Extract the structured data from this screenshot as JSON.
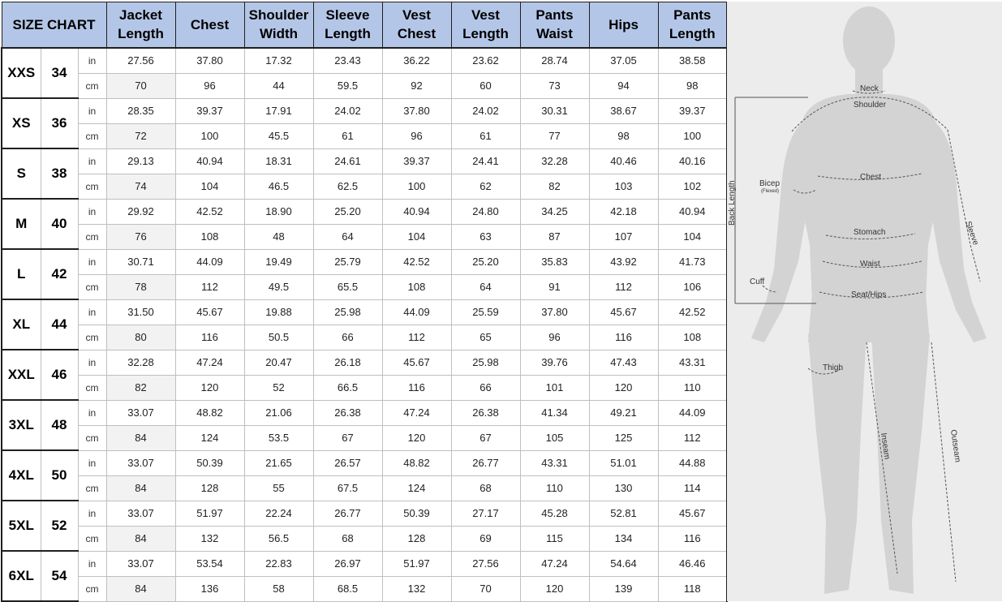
{
  "table": {
    "title": "SIZE CHART",
    "headers": [
      "Jacket\nLength",
      "Chest",
      "Shoulder\nWidth",
      "Sleeve\nLength",
      "Vest\nChest",
      "Vest\nLength",
      "Pants\nWaist",
      "Hips",
      "Pants\nLength"
    ],
    "header_lines": [
      [
        "Jacket",
        "Length"
      ],
      [
        "Chest",
        ""
      ],
      [
        "Shoulder",
        "Width"
      ],
      [
        "Sleeve",
        "Length"
      ],
      [
        "Vest",
        "Chest"
      ],
      [
        "Vest",
        "Length"
      ],
      [
        "Pants",
        "Waist"
      ],
      [
        "Hips",
        ""
      ],
      [
        "Pants",
        "Length"
      ]
    ],
    "units": {
      "in": "in",
      "cm": "cm"
    },
    "rows": [
      {
        "size": "XXS",
        "num": "34",
        "in": [
          "27.56",
          "37.80",
          "17.32",
          "23.43",
          "36.22",
          "23.62",
          "28.74",
          "37.05",
          "38.58"
        ],
        "cm": [
          "70",
          "96",
          "44",
          "59.5",
          "92",
          "60",
          "73",
          "94",
          "98"
        ]
      },
      {
        "size": "XS",
        "num": "36",
        "in": [
          "28.35",
          "39.37",
          "17.91",
          "24.02",
          "37.80",
          "24.02",
          "30.31",
          "38.67",
          "39.37"
        ],
        "cm": [
          "72",
          "100",
          "45.5",
          "61",
          "96",
          "61",
          "77",
          "98",
          "100"
        ]
      },
      {
        "size": "S",
        "num": "38",
        "in": [
          "29.13",
          "40.94",
          "18.31",
          "24.61",
          "39.37",
          "24.41",
          "32.28",
          "40.46",
          "40.16"
        ],
        "cm": [
          "74",
          "104",
          "46.5",
          "62.5",
          "100",
          "62",
          "82",
          "103",
          "102"
        ]
      },
      {
        "size": "M",
        "num": "40",
        "in": [
          "29.92",
          "42.52",
          "18.90",
          "25.20",
          "40.94",
          "24.80",
          "34.25",
          "42.18",
          "40.94"
        ],
        "cm": [
          "76",
          "108",
          "48",
          "64",
          "104",
          "63",
          "87",
          "107",
          "104"
        ]
      },
      {
        "size": "L",
        "num": "42",
        "in": [
          "30.71",
          "44.09",
          "19.49",
          "25.79",
          "42.52",
          "25.20",
          "35.83",
          "43.92",
          "41.73"
        ],
        "cm": [
          "78",
          "112",
          "49.5",
          "65.5",
          "108",
          "64",
          "91",
          "112",
          "106"
        ]
      },
      {
        "size": "XL",
        "num": "44",
        "in": [
          "31.50",
          "45.67",
          "19.88",
          "25.98",
          "44.09",
          "25.59",
          "37.80",
          "45.67",
          "42.52"
        ],
        "cm": [
          "80",
          "116",
          "50.5",
          "66",
          "112",
          "65",
          "96",
          "116",
          "108"
        ]
      },
      {
        "size": "XXL",
        "num": "46",
        "in": [
          "32.28",
          "47.24",
          "20.47",
          "26.18",
          "45.67",
          "25.98",
          "39.76",
          "47.43",
          "43.31"
        ],
        "cm": [
          "82",
          "120",
          "52",
          "66.5",
          "116",
          "66",
          "101",
          "120",
          "110"
        ]
      },
      {
        "size": "3XL",
        "num": "48",
        "in": [
          "33.07",
          "48.82",
          "21.06",
          "26.38",
          "47.24",
          "26.38",
          "41.34",
          "49.21",
          "44.09"
        ],
        "cm": [
          "84",
          "124",
          "53.5",
          "67",
          "120",
          "67",
          "105",
          "125",
          "112"
        ]
      },
      {
        "size": "4XL",
        "num": "50",
        "in": [
          "33.07",
          "50.39",
          "21.65",
          "26.57",
          "48.82",
          "26.77",
          "43.31",
          "51.01",
          "44.88"
        ],
        "cm": [
          "84",
          "128",
          "55",
          "67.5",
          "124",
          "68",
          "110",
          "130",
          "114"
        ]
      },
      {
        "size": "5XL",
        "num": "52",
        "in": [
          "33.07",
          "51.97",
          "22.24",
          "26.77",
          "50.39",
          "27.17",
          "45.28",
          "52.81",
          "45.67"
        ],
        "cm": [
          "84",
          "132",
          "56.5",
          "68",
          "128",
          "69",
          "115",
          "134",
          "116"
        ]
      },
      {
        "size": "6XL",
        "num": "54",
        "in": [
          "33.07",
          "53.54",
          "22.83",
          "26.97",
          "51.97",
          "27.56",
          "47.24",
          "54.64",
          "46.46"
        ],
        "cm": [
          "84",
          "136",
          "58",
          "68.5",
          "132",
          "70",
          "120",
          "139",
          "118"
        ]
      }
    ]
  },
  "figure": {
    "labels": {
      "neck": "Neck",
      "shoulder": "Shoulder",
      "chest": "Chest",
      "bicep": "Bicep",
      "bicep_note": "(Flexed)",
      "back_length": "Back Length",
      "sleeve": "Sleeve",
      "stomach": "Stomach",
      "waist": "Waist",
      "cuff": "Cuff",
      "seat_hips": "Seat/Hips",
      "thigh": "Thigh",
      "inseam": "Inseam",
      "outseam": "Outseam"
    },
    "colors": {
      "body": "#d1d1d1",
      "background": "#ececec",
      "header": "#b4c6e7"
    }
  }
}
